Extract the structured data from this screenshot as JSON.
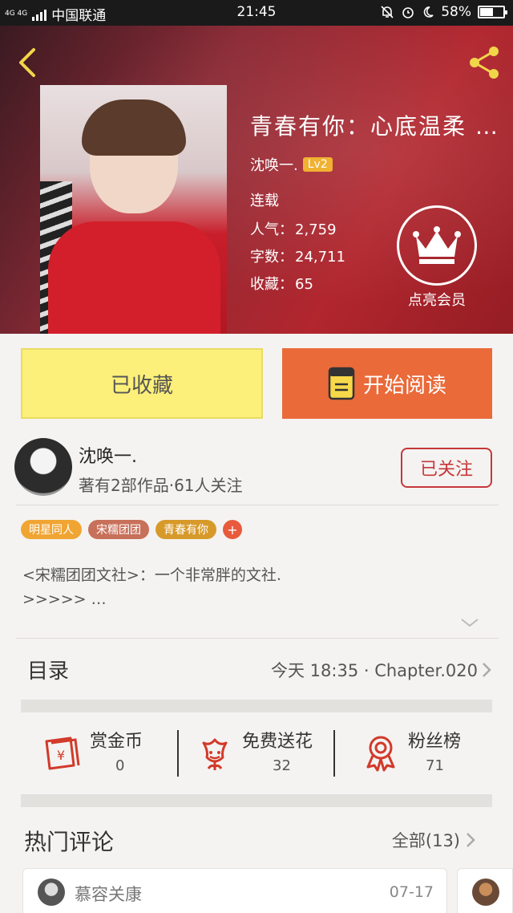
{
  "status_bar": {
    "network": "4G 4G",
    "carrier": "中国联通",
    "time": "21:45",
    "battery_percent": "58%",
    "battery_level": 0.58
  },
  "icons": {
    "back": "chevron-left-icon",
    "share": "share-icon",
    "vip": "crown-icon",
    "read": "book-icon",
    "coin": "red-envelope-icon",
    "flower": "flower-icon",
    "fans": "medal-icon"
  },
  "colors": {
    "accent_orange": "#ea6a3a",
    "fav_yellow": "#fdf07a",
    "follow_red": "#c6373a",
    "icon_red": "#d23a2a",
    "back_yellow": "#f2d64a"
  },
  "book": {
    "title": "青春有你：心底温柔 …",
    "author": "沈唤一.",
    "author_level": "Lv2",
    "status": "连载",
    "popularity_label": "人气：",
    "popularity": "2,759",
    "words_label": "字数：",
    "words": "24,711",
    "favorites_label": "收藏：",
    "favorites": "65",
    "vip_label": "点亮会员"
  },
  "buttons": {
    "favorited": "已收藏",
    "start_reading": "开始阅读"
  },
  "author_card": {
    "name": "沈唤一.",
    "info": "著有2部作品·61人关注",
    "follow": "已关注"
  },
  "tags": [
    {
      "label": "明星同人",
      "color": "#f0a533"
    },
    {
      "label": "宋糯团团",
      "color": "#c7705a"
    },
    {
      "label": "青春有你",
      "color": "#d79a2a"
    }
  ],
  "tag_add": "+",
  "description": {
    "line1": "<宋糯团团文社>：一个非常胖的文社.",
    "line2": ">>>>> …"
  },
  "toc": {
    "label": "目录",
    "latest": "今天 18:35 · Chapter.020"
  },
  "actions": [
    {
      "label": "赏金币",
      "value": "0"
    },
    {
      "label": "免费送花",
      "value": "32"
    },
    {
      "label": "粉丝榜",
      "value": "71"
    }
  ],
  "hot_comments": {
    "label": "热门评论",
    "all": "全部(13)",
    "first": {
      "name": "慕容关康",
      "date": "07-17"
    }
  }
}
